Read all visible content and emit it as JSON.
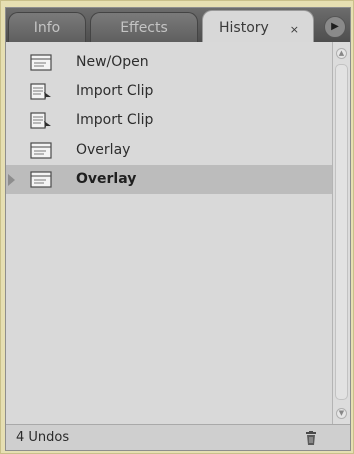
{
  "tabs": [
    {
      "label": "Info"
    },
    {
      "label": "Effects"
    },
    {
      "label": "History"
    }
  ],
  "active_tab_close": "×",
  "panel_menu_glyph": "▶",
  "history_items": [
    {
      "label": "New/Open",
      "icon": "document-icon"
    },
    {
      "label": "Import Clip",
      "icon": "import-clip-icon"
    },
    {
      "label": "Import Clip",
      "icon": "import-clip-icon"
    },
    {
      "label": "Overlay",
      "icon": "document-icon"
    },
    {
      "label": "Overlay",
      "icon": "document-icon",
      "selected": true
    }
  ],
  "footer": {
    "status": "4 Undos"
  }
}
